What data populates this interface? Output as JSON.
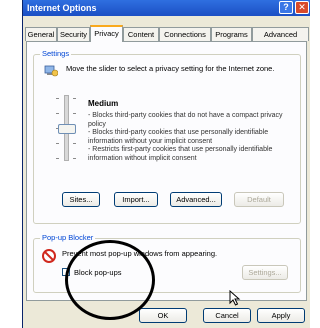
{
  "window": {
    "title": "Internet Options",
    "help_glyph": "?",
    "close_glyph": "✕"
  },
  "tabs": [
    {
      "label": "General"
    },
    {
      "label": "Security"
    },
    {
      "label": "Privacy"
    },
    {
      "label": "Content"
    },
    {
      "label": "Connections"
    },
    {
      "label": "Programs"
    },
    {
      "label": "Advanced"
    }
  ],
  "settings": {
    "group_label": "Settings",
    "instruction": "Move the slider to select a privacy setting for the Internet zone.",
    "level": "Medium",
    "descriptions": [
      "- Blocks third-party cookies that do not have a compact privacy policy",
      "- Blocks third-party cookies that use personally identifiable information without your implicit consent",
      "- Restricts first-party cookies that use personally identifiable information without implicit consent"
    ],
    "buttons": {
      "sites": "Sites...",
      "import": "Import...",
      "advanced": "Advanced...",
      "default": "Default"
    }
  },
  "popup": {
    "group_label": "Pop-up Blocker",
    "description": "Prevent most pop-up windows from appearing.",
    "checkbox_label": "Block pop-ups",
    "settings_button": "Settings..."
  },
  "footer": {
    "ok": "OK",
    "cancel": "Cancel",
    "apply": "Apply"
  },
  "colors": {
    "titlebar": "#1b4fc4",
    "active_tab_accent": "#f9a91d",
    "group_label": "#0046d5"
  }
}
